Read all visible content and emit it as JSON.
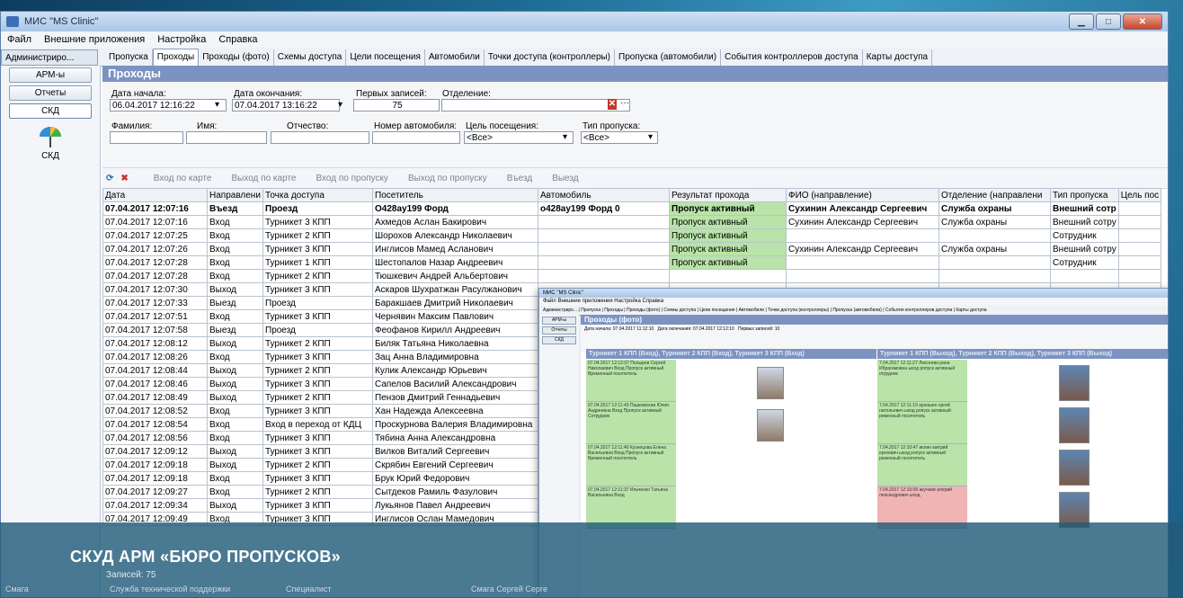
{
  "window": {
    "title": "МИС \"MS Clinic\"",
    "minimize": "▁",
    "maximize": "□",
    "close": "✕"
  },
  "menu": [
    "Файл",
    "Внешние приложения",
    "Настройка",
    "Справка"
  ],
  "left_tab": "Администриро...",
  "tabs": [
    "Пропуска",
    "Проходы",
    "Проходы (фото)",
    "Схемы доступа",
    "Цели посещения",
    "Автомобили",
    "Точки доступа (контроллеры)",
    "Пропуска (автомобили)",
    "События контроллеров доступа",
    "Карты доступа"
  ],
  "active_tab_index": 1,
  "sidebar": {
    "items": [
      "АРМ-ы",
      "Отчеты",
      "СКД"
    ],
    "icon_label": "СКД"
  },
  "page_header": "Проходы",
  "filters": {
    "date_start_label": "Дата начала:",
    "date_start_value": "06.04.2017 12:16:22",
    "date_end_label": "Дата окончания:",
    "date_end_value": "07.04.2017 13:16:22",
    "first_records_label": "Первых записей:",
    "first_records_value": "75",
    "department_label": "Отделение:",
    "surname_label": "Фамилия:",
    "name_label": "Имя:",
    "patronymic_label": "Отчество:",
    "car_number_label": "Номер автомобиля:",
    "visit_purpose_label": "Цель посещения:",
    "visit_purpose_value": "<Все>",
    "pass_type_label": "Тип пропуска:",
    "pass_type_value": "<Все>"
  },
  "toolbar": [
    "Вход по карте",
    "Выход по карте",
    "Вход по пропуску",
    "Выход по пропуску",
    "Въезд",
    "Выезд"
  ],
  "table": {
    "headers": [
      "Дата",
      "Направлени",
      "Точка доступа",
      "Посетитель",
      "Автомобиль",
      "Результат прохода",
      "ФИО (направление)",
      "Отделение (направлени",
      "Тип пропуска",
      "Цель пос"
    ],
    "rows": [
      [
        "07.04.2017 12:07:16",
        "Въезд",
        "Проезд",
        "О428ау199 Форд",
        "о428ау199 Форд 0",
        "Пропуск активный",
        "Сухинин Александр Сергеевич",
        "Служба охраны",
        "Внешний сотр",
        ""
      ],
      [
        "07.04.2017 12:07:16",
        "Вход",
        "Турникет 3 КПП",
        "Ахмедов Аслан Бакирович",
        "",
        "Пропуск активный",
        "Сухинин Александр Сергеевич",
        "Служба охраны",
        "Внешний сотру",
        ""
      ],
      [
        "07.04.2017 12:07:25",
        "Вход",
        "Турникет 2 КПП",
        "Шорохов Александр Николаевич",
        "",
        "Пропуск активный",
        "",
        "",
        "Сотрудник",
        ""
      ],
      [
        "07.04.2017 12:07:26",
        "Вход",
        "Турникет 3 КПП",
        "Инглисов Мамед Асланович",
        "",
        "Пропуск активный",
        "Сухинин Александр Сергеевич",
        "Служба охраны",
        "Внешний сотру",
        ""
      ],
      [
        "07.04.2017 12:07:28",
        "Вход",
        "Турникет 1 КПП",
        "Шестопалов Назар Андреевич",
        "",
        "Пропуск активный",
        "",
        "",
        "Сотрудник",
        ""
      ],
      [
        "07.04.2017 12:07:28",
        "Вход",
        "Турникет 2 КПП",
        "Тюшкевич Андрей Альбертович",
        "",
        "",
        "",
        "",
        "",
        ""
      ],
      [
        "07.04.2017 12:07:30",
        "Выход",
        "Турникет 3 КПП",
        "Аскаров Шухратжан Расулжанович",
        "",
        "",
        "",
        "",
        "",
        ""
      ],
      [
        "07.04.2017 12:07:33",
        "Выезд",
        "Проезд",
        "Баракшаев Дмитрий Николаевич",
        "",
        "",
        "",
        "",
        "",
        ""
      ],
      [
        "07.04.2017 12:07:51",
        "Вход",
        "Турникет 3 КПП",
        "Чернявин Максим Павлович",
        "",
        "",
        "",
        "",
        "",
        ""
      ],
      [
        "07.04.2017 12:07:58",
        "Выезд",
        "Проезд",
        "Феофанов Кирилл Андреевич",
        "",
        "",
        "",
        "",
        "",
        ""
      ],
      [
        "07.04.2017 12:08:12",
        "Выход",
        "Турникет 2 КПП",
        "Биляк Татьяна Николаевна",
        "",
        "",
        "",
        "",
        "",
        ""
      ],
      [
        "07.04.2017 12:08:26",
        "Вход",
        "Турникет 3 КПП",
        "Зац Анна Владимировна",
        "",
        "",
        "",
        "",
        "",
        ""
      ],
      [
        "07.04.2017 12:08:44",
        "Выход",
        "Турникет 2 КПП",
        "Кулик Александр Юрьевич",
        "",
        "",
        "",
        "",
        "",
        ""
      ],
      [
        "07.04.2017 12:08:46",
        "Выход",
        "Турникет 3 КПП",
        "Сапелов Василий Александрович",
        "",
        "",
        "",
        "",
        "",
        ""
      ],
      [
        "07.04.2017 12:08:49",
        "Выход",
        "Турникет 2 КПП",
        "Пензов Дмитрий Геннадьевич",
        "",
        "",
        "",
        "",
        "",
        ""
      ],
      [
        "07.04.2017 12:08:52",
        "Вход",
        "Турникет 3 КПП",
        "Хан Надежда Алексеевна",
        "",
        "",
        "",
        "",
        "",
        ""
      ],
      [
        "07.04.2017 12:08:54",
        "Вход",
        "Вход в переход от КДЦ",
        "Проскурнова Валерия Владимировна",
        "",
        "",
        "",
        "",
        "",
        ""
      ],
      [
        "07.04.2017 12:08:56",
        "Вход",
        "Турникет 3 КПП",
        "Тябина Анна Александровна",
        "",
        "",
        "",
        "",
        "",
        ""
      ],
      [
        "07.04.2017 12:09:12",
        "Выход",
        "Турникет 3 КПП",
        "Вилков Виталий Сергеевич",
        "",
        "",
        "",
        "",
        "",
        ""
      ],
      [
        "07.04.2017 12:09:18",
        "Выход",
        "Турникет 2 КПП",
        "Скрябин Евгений Сергеевич",
        "",
        "",
        "",
        "",
        "",
        ""
      ],
      [
        "07.04.2017 12:09:18",
        "Вход",
        "Турникет 3 КПП",
        "Брук Юрий Федорович",
        "",
        "",
        "",
        "",
        "",
        ""
      ],
      [
        "07.04.2017 12:09:27",
        "Вход",
        "Турникет 2 КПП",
        "Сытдеков Рамиль Фазулович",
        "",
        "",
        "",
        "",
        "",
        ""
      ],
      [
        "07.04.2017 12:09:34",
        "Выход",
        "Турникет 3 КПП",
        "Лукьянов Павел Андреевич",
        "",
        "",
        "",
        "",
        "",
        ""
      ],
      [
        "07.04.2017 12:09:49",
        "Вход",
        "Турникет 3 КПП",
        "Инглисов Ослан Мамедович",
        "",
        "",
        "",
        "",
        "",
        ""
      ]
    ]
  },
  "record_count": "Записей: 75",
  "overlay": {
    "title": "МИС \"MS Clinic\"",
    "header": "Проходы (фото)",
    "col1": "Турникет 1 КПП (Вход), Турникет 2 КПП (Вход), Турникет 3 КПП (Вход)",
    "col2": "Турникет 1 КПП (Выход), Турникет 2 КПП (Выход), Турникет 3 КПП (Выход)",
    "date_start": "07.04.2017 11:12:10",
    "date_end": "07.04.2017 12:12:10",
    "first_records": "10",
    "cards_left": [
      "07.04.2017 12:12:07 Полырев Сергей Николаевич Вход Пропуск активный Временный посетитель",
      "07.04.2017 12:11:43 Пашковская Юлия Андреевна Вход Пропуск активный Сотрудник",
      "07.04.2017 12:11:40 Кузнецова Елена Васильевна Вход Пропуск активный Временный посетитель",
      "07.04.2017 12:11:37 Ильченко Татьяна Васильевна Вход"
    ],
    "cards_right": [
      "7.04.2017 12:11:27 Лексеева рина Ибрагимовна ыход ропуск активный отрудник",
      "7.04.2017 12:11:19 архишин ергей натольевич ыход ропуск активный ременный посетитель",
      "7.04.2017 12:10:47 иклин митрий ергеевич ыход ропуск активный ременный посетитель",
      "7.04.2017 12:10:06 акучаев алерий лександрович ыход"
    ]
  },
  "banner_title": "СКУД АРМ «БЮРО ПРОПУСКОВ»",
  "statusbar": [
    "Смага",
    "Служба технической поддержки",
    "Специалист",
    "Смага Сергей Серге"
  ]
}
